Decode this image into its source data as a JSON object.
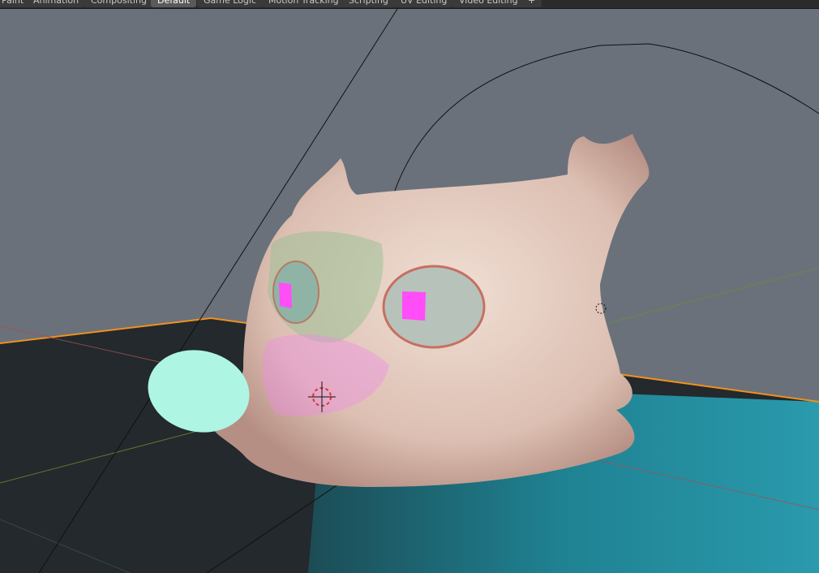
{
  "workspace_tabs": [
    {
      "label": "Paint"
    },
    {
      "label": "Animation"
    },
    {
      "label": "Compositing"
    },
    {
      "label": "Default",
      "active": true
    },
    {
      "label": "Game Logic"
    },
    {
      "label": "Motion Tracking"
    },
    {
      "label": "Scripting"
    },
    {
      "label": "UV Editing"
    },
    {
      "label": "Video Editing"
    },
    {
      "label": "+"
    }
  ],
  "colors": {
    "viewport_bg": "#6b717a",
    "selection_outline": "#f0901e",
    "floor_teal": "#2596a8",
    "model_skin": "#e8d2c6",
    "missing_texture": "#ff4df8",
    "eye_mint": "#aef5e4"
  }
}
